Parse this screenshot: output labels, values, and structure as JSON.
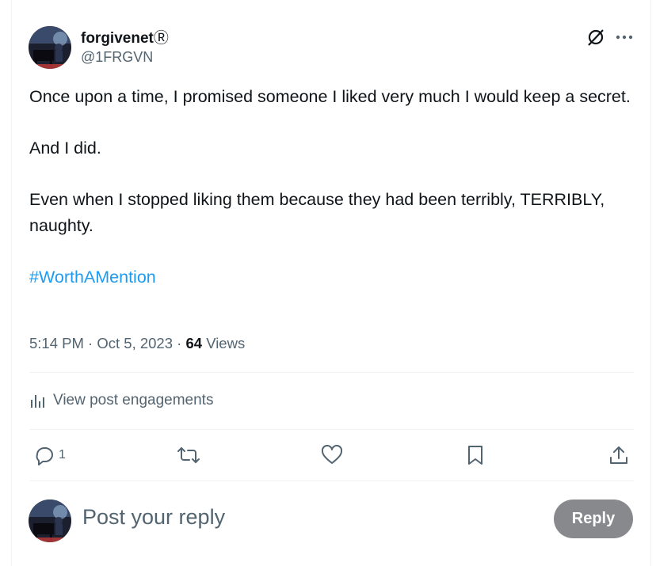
{
  "author": {
    "display_name": "forgivenet",
    "badge": "Ⓡ",
    "handle": "@1FRGVN"
  },
  "tweet": {
    "paragraphs": [
      "Once upon a time, I promised someone I liked very much I would keep a secret.",
      "And I did.",
      "Even when I stopped liking them because they had been terribly, TERRIBLY, naughty."
    ],
    "hashtag": "#WorthAMention"
  },
  "meta": {
    "time": "5:14 PM",
    "separator": "·",
    "date": "Oct 5, 2023",
    "views_count": "64",
    "views_label": "Views"
  },
  "engagements_label": "View post engagements",
  "actions": {
    "reply_count": "1",
    "icons": [
      "reply-icon",
      "repost-icon",
      "like-icon",
      "bookmark-icon",
      "share-icon"
    ]
  },
  "reply_composer": {
    "placeholder": "Post your reply",
    "button_label": "Reply"
  },
  "colors": {
    "accent": "#1d9bf0",
    "muted_text": "#536471",
    "reply_button_disabled": "#87898c"
  }
}
